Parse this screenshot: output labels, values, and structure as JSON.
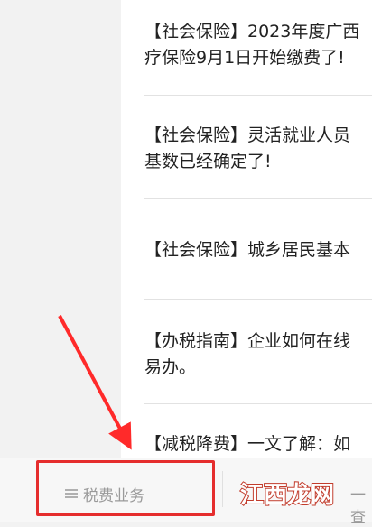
{
  "news": [
    {
      "lines": [
        "【社会保险】2023年度广西",
        "疗保险9月1日开始缴费了!"
      ]
    },
    {
      "lines": [
        "【社会保险】灵活就业人员",
        "基数已经确定了!"
      ]
    },
    {
      "lines": [
        "【社会保险】城乡居民基本"
      ]
    },
    {
      "lines": [
        "【办税指南】企业如何在线",
        "易办。"
      ]
    },
    {
      "lines": [
        "【减税降费】一文了解：如"
      ]
    }
  ],
  "tabbar": {
    "left_label": "税费业务",
    "right_label": "一查"
  },
  "watermark": {
    "text": "江西龙网"
  },
  "colors": {
    "highlight_box": "#e52d2d",
    "arrow": "#ff2a2a",
    "watermark": "#c23c2c"
  }
}
